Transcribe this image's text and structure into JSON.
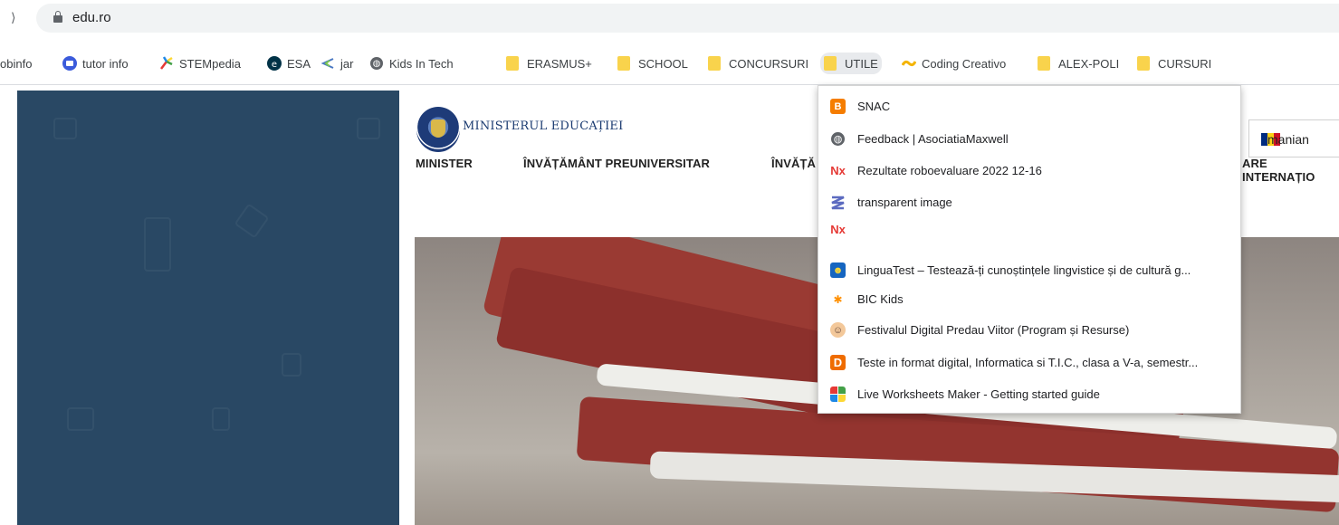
{
  "browser": {
    "nav_glyph": "⟩",
    "url": "edu.ro"
  },
  "bookmarks": [
    {
      "label": "obinfo",
      "icon": "none"
    },
    {
      "label": "tutor info",
      "icon": "tutor-info-icon"
    },
    {
      "label": "STEMpedia",
      "icon": "stempedia-icon"
    },
    {
      "label": "ESA",
      "icon": "esa-icon"
    },
    {
      "label": "jar",
      "icon": "jar-icon"
    },
    {
      "label": "Kids In Tech",
      "icon": "globe-icon"
    },
    {
      "label": "ERASMUS+",
      "icon": "folder-icon"
    },
    {
      "label": "SCHOOL",
      "icon": "folder-icon"
    },
    {
      "label": "CONCURSURI",
      "icon": "folder-icon"
    },
    {
      "label": "UTILE",
      "icon": "folder-icon"
    },
    {
      "label": "Coding Creativo",
      "icon": "coding-creativo-icon"
    },
    {
      "label": "ALEX-POLI",
      "icon": "folder-icon"
    },
    {
      "label": "CURSURI",
      "icon": "folder-icon"
    }
  ],
  "utile_menu": [
    {
      "label": "SNAC",
      "icon": "blogger-icon"
    },
    {
      "label": "Feedback | AsociatiaMaxwell",
      "icon": "globe-icon"
    },
    {
      "label": "Rezultate roboevaluare 2022 12-16",
      "icon": "nx-icon"
    },
    {
      "label": "transparent image",
      "icon": "stripes-icon"
    },
    {
      "label": "",
      "icon": "nx-icon"
    },
    {
      "label": "LinguaTest – Testează-ți cunoștințele lingvistice și de cultură g...",
      "icon": "linguatest-icon"
    },
    {
      "label": "BIC Kids",
      "icon": "bic-kids-icon"
    },
    {
      "label": "Festivalul Digital Predau Viitor (Program și Resurse)",
      "icon": "avatar-icon"
    },
    {
      "label": "Teste in format digital, Informatica si T.I.C., clasa a V-a, semestr...",
      "icon": "d-letter-icon"
    },
    {
      "label": "Live Worksheets Maker - Getting started guide",
      "icon": "liveworksheets-icon"
    }
  ],
  "site": {
    "ministry_name": "MINISTERUL EDUCAȚIEI",
    "language": "manian",
    "nav": {
      "minister": "MINISTER",
      "preuniversitar": "ÎNVĂȚĂMÂNT PREUNIVERSITAR",
      "superior": "ÎNVĂȚĂ",
      "international": "ARE INTERNAȚIO"
    }
  },
  "colors": {
    "left_panel": "#294864",
    "folder": "#f9d34c",
    "ministry_blue": "#1a3a70"
  }
}
